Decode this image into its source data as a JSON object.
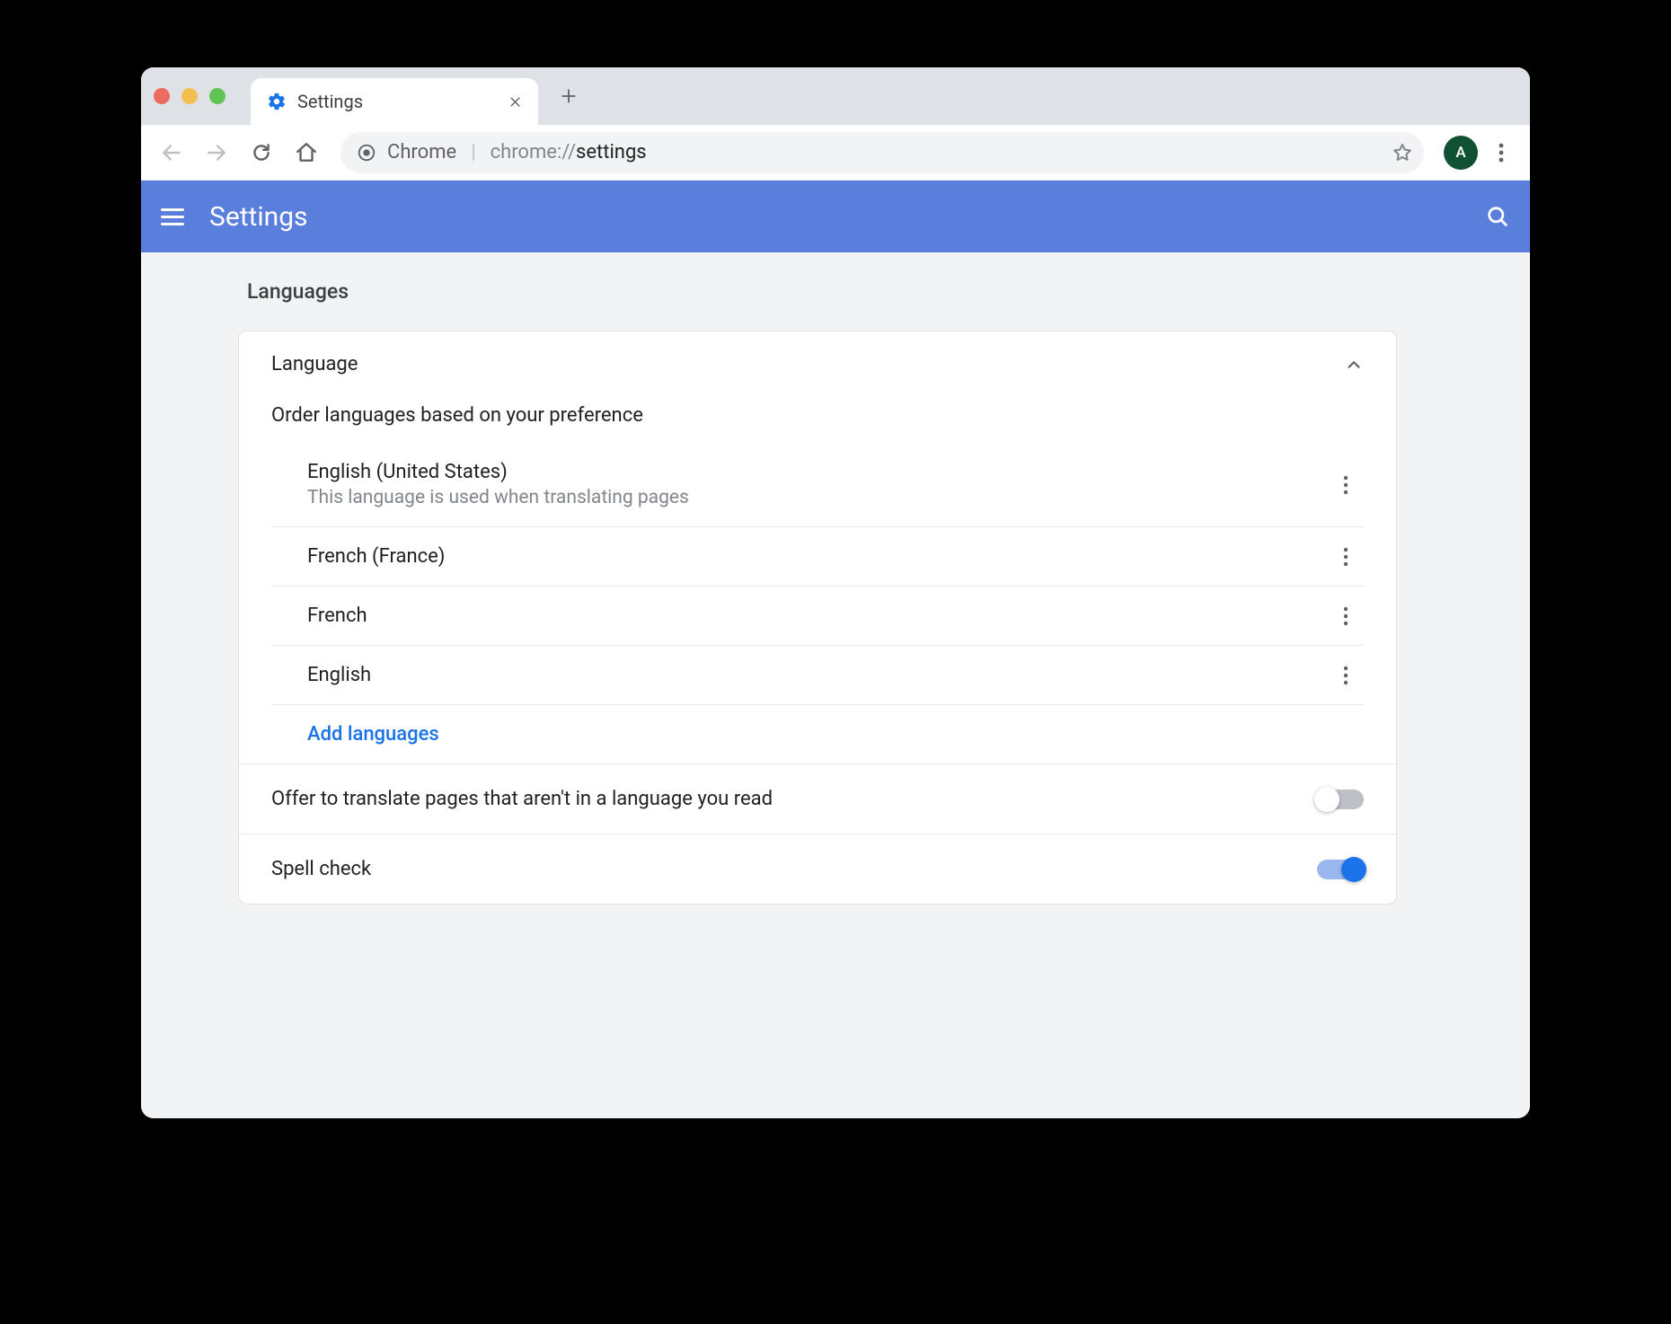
{
  "browser": {
    "tab_title": "Settings",
    "omnibox_origin": "Chrome",
    "omnibox_url_prefix": "chrome://",
    "omnibox_url_path": "settings",
    "profile_initial": "A"
  },
  "header": {
    "title": "Settings"
  },
  "page": {
    "section_title": "Languages",
    "language_card": {
      "title": "Language",
      "subtitle": "Order languages based on your preference",
      "languages": [
        {
          "name": "English (United States)",
          "desc": "This language is used when translating pages"
        },
        {
          "name": "French (France)",
          "desc": ""
        },
        {
          "name": "French",
          "desc": ""
        },
        {
          "name": "English",
          "desc": ""
        }
      ],
      "add_label": "Add languages"
    },
    "translate_row": {
      "label": "Offer to translate pages that aren't in a language you read",
      "enabled": false
    },
    "spellcheck_row": {
      "label": "Spell check",
      "enabled": true
    }
  }
}
